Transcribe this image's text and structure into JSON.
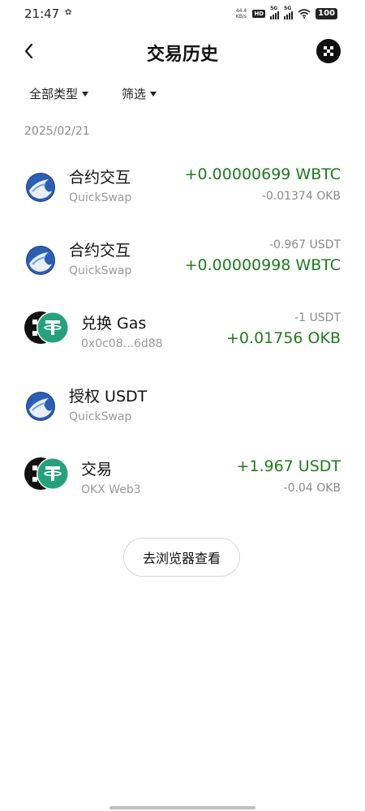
{
  "status_bar": {
    "time": "21:47",
    "net_speed_value": "44.4",
    "net_speed_unit": "KB/s",
    "hd_badge": "HD",
    "signal_label": "5G",
    "battery": "100"
  },
  "header": {
    "title": "交易历史"
  },
  "filters": {
    "type_label": "全部类型",
    "filter_label": "筛选"
  },
  "date_label": "2025/02/21",
  "transactions": [
    {
      "title": "合约交互",
      "subtitle": "QuickSwap",
      "amount_primary": "+0.00000699 WBTC",
      "amount_secondary": "-0.01374 OKB",
      "icon": "quickswap-icon"
    },
    {
      "title": "合约交互",
      "subtitle": "QuickSwap",
      "amount_secondary": "-0.967 USDT",
      "amount_primary": "+0.00000998 WBTC",
      "icon": "quickswap-icon"
    },
    {
      "title": "兑换 Gas",
      "subtitle": "0x0c08...6d88",
      "amount_secondary": "-1 USDT",
      "amount_primary": "+0.01756 OKB",
      "icon": "okx-usdt-pair-icon"
    },
    {
      "title": "授权 USDT",
      "subtitle": "QuickSwap",
      "icon": "quickswap-icon"
    },
    {
      "title": "交易",
      "subtitle": "OKX Web3",
      "amount_primary": "+1.967 USDT",
      "amount_secondary": "-0.04 OKB",
      "icon": "okx-usdt-pair-icon"
    }
  ],
  "explorer_button": "去浏览器查看",
  "colors": {
    "positive": "#1f7a1f",
    "muted": "#8a8a8a",
    "usdt": "#26a17b"
  }
}
